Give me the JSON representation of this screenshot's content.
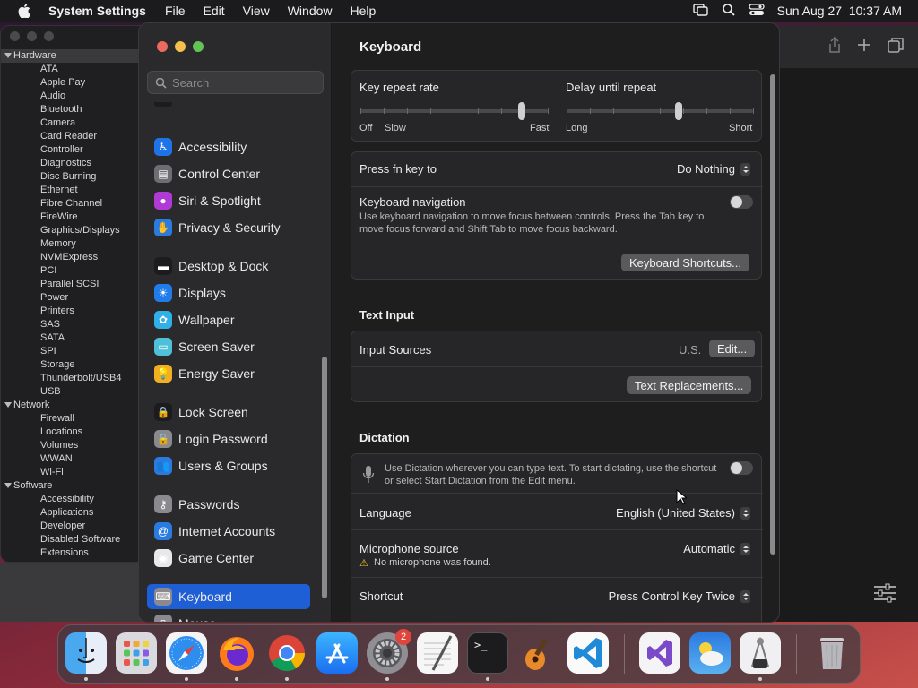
{
  "menubar": {
    "app_name": "System Settings",
    "menus": [
      "File",
      "Edit",
      "View",
      "Window",
      "Help"
    ],
    "clock": "Sun Aug 27  10:37 AM",
    "status_icons": [
      "screen-mirroring-icon",
      "search-icon",
      "control-center-icon"
    ]
  },
  "system_info_tree": {
    "groups": [
      {
        "name": "Hardware",
        "items": [
          "ATA",
          "Apple Pay",
          "Audio",
          "Bluetooth",
          "Camera",
          "Card Reader",
          "Controller",
          "Diagnostics",
          "Disc Burning",
          "Ethernet",
          "Fibre Channel",
          "FireWire",
          "Graphics/Displays",
          "Memory",
          "NVMExpress",
          "PCI",
          "Parallel SCSI",
          "Power",
          "Printers",
          "SAS",
          "SATA",
          "SPI",
          "Storage",
          "Thunderbolt/USB4",
          "USB"
        ]
      },
      {
        "name": "Network",
        "items": [
          "Firewall",
          "Locations",
          "Volumes",
          "WWAN",
          "Wi-Fi"
        ]
      },
      {
        "name": "Software",
        "items": [
          "Accessibility",
          "Applications",
          "Developer",
          "Disabled Software",
          "Extensions"
        ]
      }
    ]
  },
  "sidebar": {
    "search_placeholder": "Search",
    "items": [
      {
        "label": "Accessibility",
        "icon": "accessibility-icon",
        "color": "#1e73e8",
        "glyph": "♿"
      },
      {
        "label": "Control Center",
        "icon": "control-center-icon",
        "color": "#6e6e72",
        "glyph": "▤"
      },
      {
        "label": "Siri & Spotlight",
        "icon": "siri-icon",
        "color": "#b03ad6",
        "glyph": "●"
      },
      {
        "label": "Privacy & Security",
        "icon": "hand-icon",
        "color": "#2a7be0",
        "glyph": "✋"
      },
      {
        "label": "Desktop & Dock",
        "icon": "desktop-dock-icon",
        "color": "#1c1c1e",
        "glyph": "▬"
      },
      {
        "label": "Displays",
        "icon": "displays-icon",
        "color": "#1f7ce8",
        "glyph": "☀"
      },
      {
        "label": "Wallpaper",
        "icon": "wallpaper-icon",
        "color": "#30b0e8",
        "glyph": "✿"
      },
      {
        "label": "Screen Saver",
        "icon": "screen-saver-icon",
        "color": "#4ec0d8",
        "glyph": "▭"
      },
      {
        "label": "Energy Saver",
        "icon": "energy-saver-icon",
        "color": "#f0b020",
        "glyph": "💡"
      },
      {
        "label": "Lock Screen",
        "icon": "lock-icon",
        "color": "#1c1c1e",
        "glyph": "🔒"
      },
      {
        "label": "Login Password",
        "icon": "login-password-icon",
        "color": "#8a8a8e",
        "glyph": "🔒"
      },
      {
        "label": "Users & Groups",
        "icon": "users-groups-icon",
        "color": "#2a7be0",
        "glyph": "👥"
      },
      {
        "label": "Passwords",
        "icon": "key-icon",
        "color": "#8a8a8e",
        "glyph": "⚷"
      },
      {
        "label": "Internet Accounts",
        "icon": "at-icon",
        "color": "#2a7be0",
        "glyph": "@"
      },
      {
        "label": "Game Center",
        "icon": "game-center-icon",
        "color": "#e8e8e8",
        "glyph": "◉"
      },
      {
        "label": "Keyboard",
        "icon": "keyboard-icon",
        "color": "#8a8a8e",
        "glyph": "⌨",
        "selected": true
      },
      {
        "label": "Mouse",
        "icon": "mouse-icon",
        "color": "#8a8a8e",
        "glyph": "▯"
      }
    ]
  },
  "content": {
    "title": "Keyboard",
    "key_repeat": {
      "label": "Key repeat rate",
      "left": "Off",
      "left2": "Slow",
      "right": "Fast",
      "value": 0.86
    },
    "delay_repeat": {
      "label": "Delay until repeat",
      "left": "Long",
      "right": "Short",
      "value": 0.6
    },
    "fn_key": {
      "label": "Press fn key to",
      "value": "Do Nothing"
    },
    "keyboard_nav": {
      "label": "Keyboard navigation",
      "desc": "Use keyboard navigation to move focus between controls. Press the Tab key to move focus forward and Shift Tab to move focus backward.",
      "enabled": false
    },
    "shortcuts_button": "Keyboard Shortcuts...",
    "text_input": {
      "heading": "Text Input",
      "sources_label": "Input Sources",
      "sources_value": "U.S.",
      "edit_button": "Edit...",
      "replacements_button": "Text Replacements..."
    },
    "dictation": {
      "heading": "Dictation",
      "desc": "Use Dictation wherever you can type text. To start dictating, use the shortcut or select Start Dictation from the Edit menu.",
      "enabled": false,
      "language_label": "Language",
      "language_value": "English (United States)",
      "mic_label": "Microphone source",
      "mic_value": "Automatic",
      "mic_warning": "No microphone was found.",
      "shortcut_label": "Shortcut",
      "shortcut_value": "Press Control Key Twice"
    }
  },
  "dock": {
    "apps": [
      "Finder",
      "Launchpad",
      "Safari",
      "Firefox",
      "Chrome",
      "App Store",
      "System Settings",
      "TextEdit",
      "Terminal",
      "GarageBand",
      "VS Code",
      "Visual Studio",
      "Weather",
      "Xcode Simulator",
      "Trash"
    ],
    "settings_badge": "2"
  }
}
